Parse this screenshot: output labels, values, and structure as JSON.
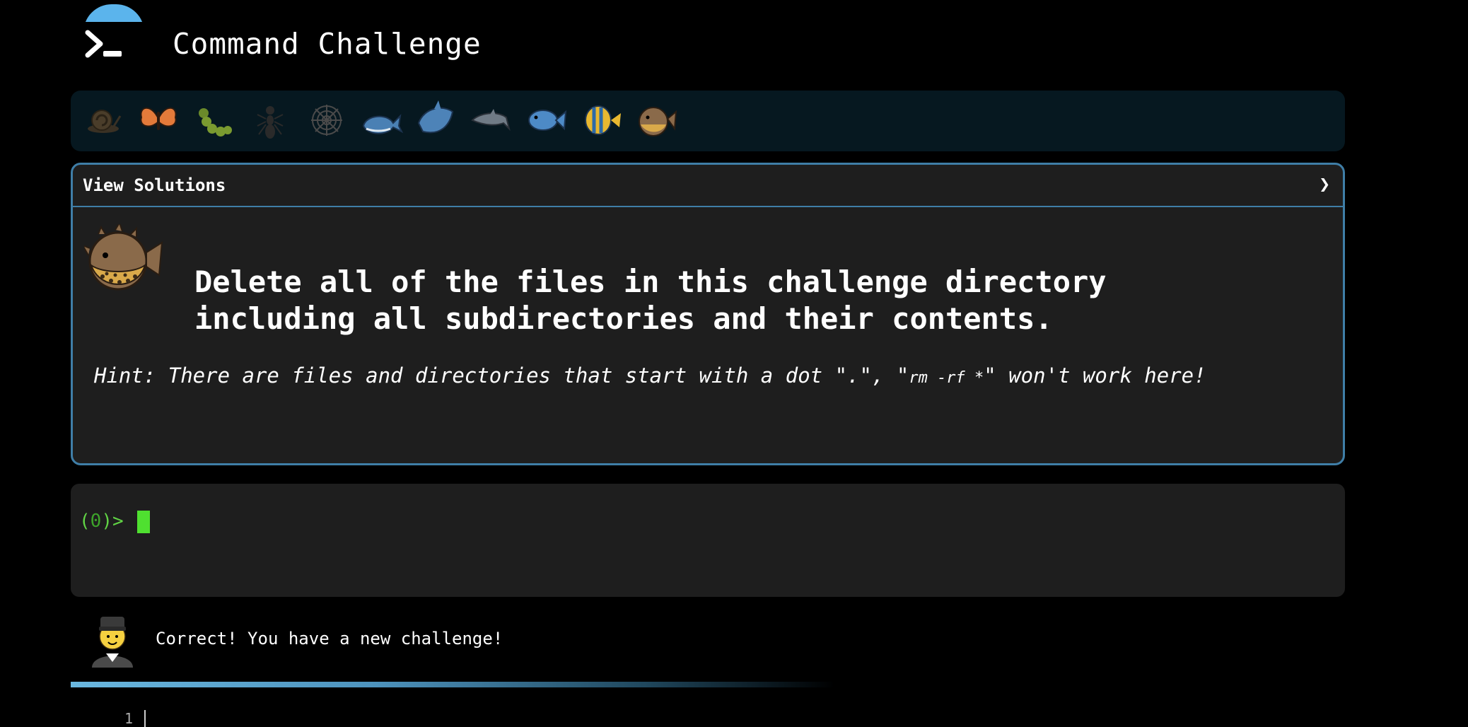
{
  "app": {
    "title": "Command Challenge"
  },
  "colors": {
    "background": "#000000",
    "panel": "#1e1e1e",
    "panel_border": "#3f7ea7",
    "level_strip": "#061820",
    "prompt_green": "#61d445",
    "accent_blue": "#5bb4ec"
  },
  "levels": [
    {
      "icon": "snail-icon"
    },
    {
      "icon": "butterfly-icon"
    },
    {
      "icon": "caterpillar-icon"
    },
    {
      "icon": "ant-icon"
    },
    {
      "icon": "spider-web-icon"
    },
    {
      "icon": "whale-icon"
    },
    {
      "icon": "shark-icon"
    },
    {
      "icon": "dolphin-icon"
    },
    {
      "icon": "fish-icon"
    },
    {
      "icon": "tropical-fish-icon"
    },
    {
      "icon": "blowfish-icon"
    }
  ],
  "challenge": {
    "solutions_label": "View Solutions",
    "chevron": "❯",
    "icon": "blowfish-icon",
    "text": "Delete all of the files in this challenge directory including all subdirectories and their contents.",
    "hint_prefix": "Hint: There are files and directories that start with a dot \".\", \"",
    "hint_cmd": "rm -rf *",
    "hint_suffix": "\" won't work here!"
  },
  "terminal": {
    "prompt_open": "(",
    "prompt_count": "0",
    "prompt_close": ")>"
  },
  "status": {
    "avatar_icon": "person-avatar-icon",
    "message": "Correct! You have a new challenge!"
  },
  "editor": {
    "line_number": "1"
  }
}
